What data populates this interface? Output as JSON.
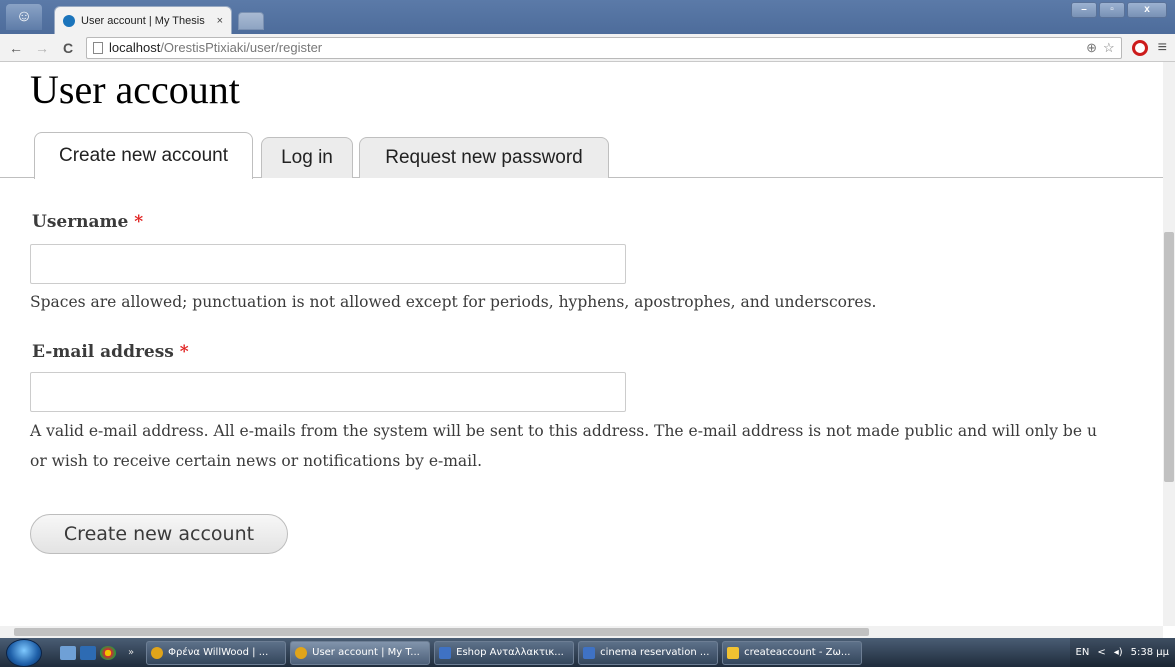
{
  "browser": {
    "tab_title": "User account | My Thesis",
    "tab_close": "×",
    "url_host": "localhost",
    "url_path": "/OrestisPtixiaki/user/register",
    "window_controls": {
      "minimize": "–",
      "maximize": "▫",
      "close": "x"
    },
    "nav": {
      "back": "←",
      "forward": "→",
      "reload": "C"
    },
    "omnibox_icons": {
      "search": "⊕",
      "bookmark": "☆"
    },
    "menu": "≡"
  },
  "page": {
    "title": "User account",
    "tabs": [
      {
        "label": "Create new account"
      },
      {
        "label": "Log in"
      },
      {
        "label": "Request new password"
      }
    ],
    "username": {
      "label": "Username",
      "required_mark": "*",
      "value": "",
      "help": "Spaces are allowed; punctuation is not allowed except for periods, hyphens, apostrophes, and underscores."
    },
    "email": {
      "label": "E-mail address",
      "required_mark": "*",
      "value": "",
      "help_line1": "A valid e-mail address. All e-mails from the system will be sent to this address. The e-mail address is not made public and will only be u",
      "help_line2": "or wish to receive certain news or notifications by e-mail."
    },
    "submit_label": "Create new account"
  },
  "taskbar": {
    "quick_more": "»",
    "buttons": [
      {
        "label": "Φρένα WillWood | ...",
        "icon": "chrome"
      },
      {
        "label": "User account | My T...",
        "icon": "chrome"
      },
      {
        "label": "Eshop Ανταλλακτικ...",
        "icon": "word"
      },
      {
        "label": "cinema reservation ...",
        "icon": "word"
      },
      {
        "label": "createaccount - Ζω...",
        "icon": "visual-studio"
      }
    ],
    "tray": {
      "language": "EN",
      "arrow": "<",
      "volume": "◂)",
      "time": "5:38 μμ"
    }
  },
  "colors": {
    "required": "#e0201f",
    "titlebar": "#5b7aa8",
    "taskbar": "#1f2c3c"
  }
}
